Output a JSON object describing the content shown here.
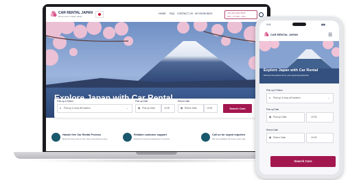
{
  "brand": {
    "name": "CAR RENTAL JAPAN",
    "tagline": "Rent a car in Japan easily",
    "accent": "#a3174f",
    "dark": "#1d2b4a",
    "teal": "#19586d"
  },
  "nav": {
    "items": [
      "HOME",
      "FAQ",
      "CONTACT US",
      "MY BOOKINGS"
    ],
    "phone_line1": "+81 (0)3 1234 5678",
    "phone_line2": "Mon - Fri 9am - 6pm",
    "lang_icon": "globe-icon"
  },
  "hero": {
    "title": "Explore Japan with Car Rental",
    "subtitle": "Discover the perfect car for your upcoming adventure"
  },
  "search": {
    "pickup_label": "Pick-up & Return",
    "pickup_placeholder": "Pick-up & drop-off location",
    "pickup_date_label": "Pick-up Date",
    "pickup_date_placeholder": "Pick-up Date",
    "pickup_time": "10:00",
    "return_date_label": "Return Date",
    "return_date_placeholder": "Return Date",
    "return_time": "10:00",
    "button": "Search Cars"
  },
  "features": [
    {
      "icon": "shield-icon",
      "title": "Hassle free Car Rental Process",
      "desc": "Book the best cars at the most competitive prices"
    },
    {
      "icon": "headset-icon",
      "title": "Reliable customer support",
      "desc": "Nothing is beyond assistance & service"
    },
    {
      "icon": "phone-icon",
      "title": "Call us for urgent inquiries",
      "desc": "We are available 24 hours every day"
    }
  ],
  "mobile": {
    "time": "9:41",
    "search_button": "Search Cars",
    "hero_title": "Explore Japan with Car Rental",
    "hero_subtitle": "Discover the perfect car for your upcoming adventure"
  }
}
